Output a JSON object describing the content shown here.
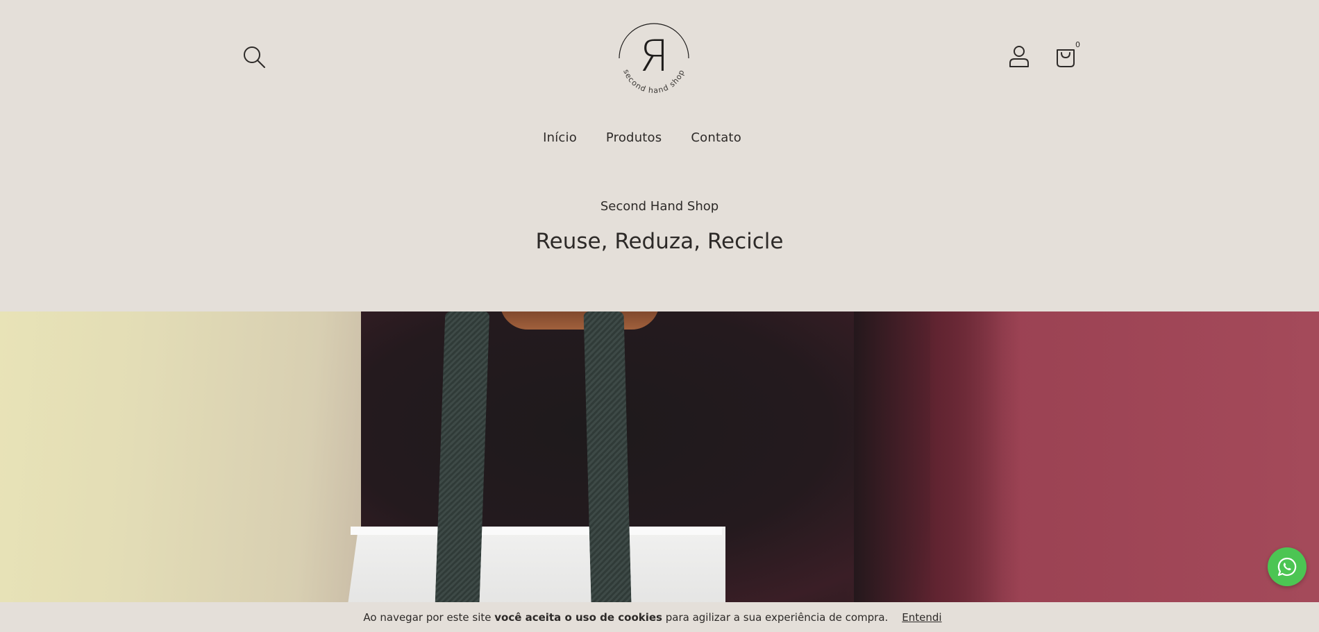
{
  "header": {
    "logo_mark": "Я",
    "logo_text": "second hand shop",
    "cart_count": "0"
  },
  "nav": {
    "items": [
      {
        "label": "Início"
      },
      {
        "label": "Produtos"
      },
      {
        "label": "Contato"
      }
    ]
  },
  "intro": {
    "subtitle": "Second Hand Shop",
    "headline": "Reuse, Reduza, Recicle"
  },
  "cookie_bar": {
    "text_before": "Ao navegar por este site ",
    "text_bold": "você aceita o uso de cookies",
    "text_after": " para agilizar a sua experiência de compra.",
    "accept_label": "Entendi"
  },
  "icons": {
    "search": "search-icon",
    "account": "user-icon",
    "cart": "shopping-bag-icon",
    "whatsapp": "whatsapp-icon"
  },
  "colors": {
    "background": "#e4dfd9",
    "text": "#2d2a28",
    "whatsapp": "#4cc553"
  }
}
